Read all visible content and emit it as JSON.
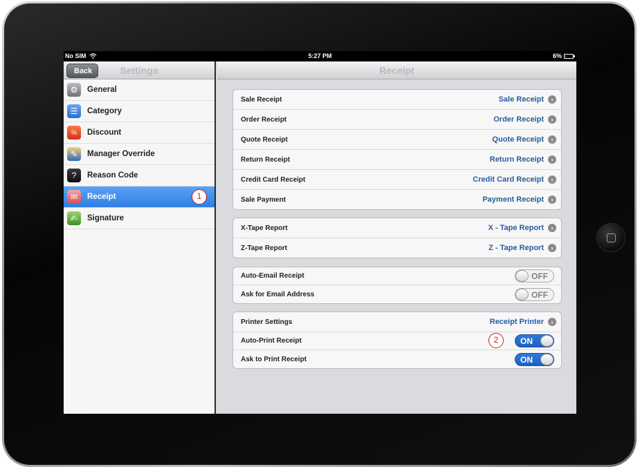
{
  "status_bar": {
    "carrier": "No SIM",
    "time": "5:27 PM",
    "battery": "6%"
  },
  "master": {
    "back_label": "Back",
    "title": "Settings",
    "items": [
      {
        "label": "General",
        "icon": "gear-icon",
        "active": false
      },
      {
        "label": "Category",
        "icon": "list-icon",
        "active": false
      },
      {
        "label": "Discount",
        "icon": "discount-tag-icon",
        "active": false
      },
      {
        "label": "Manager Override",
        "icon": "manager-icon",
        "active": false
      },
      {
        "label": "Reason Code",
        "icon": "reason-icon",
        "active": false
      },
      {
        "label": "Receipt",
        "icon": "receipt-icon",
        "active": true
      },
      {
        "label": "Signature",
        "icon": "signature-icon",
        "active": false
      }
    ]
  },
  "detail": {
    "title": "Receipt",
    "group1": [
      {
        "label": "Sale Receipt",
        "value": "Sale Receipt"
      },
      {
        "label": "Order Receipt",
        "value": "Order Receipt"
      },
      {
        "label": "Quote Receipt",
        "value": "Quote Receipt"
      },
      {
        "label": "Return Receipt",
        "value": "Return Receipt"
      },
      {
        "label": "Credit Card Receipt",
        "value": "Credit Card Receipt"
      },
      {
        "label": "Sale Payment",
        "value": "Payment Receipt"
      }
    ],
    "group2": [
      {
        "label": "X-Tape Report",
        "value": "X - Tape Report"
      },
      {
        "label": "Z-Tape Report",
        "value": "Z - Tape Report"
      }
    ],
    "group3": [
      {
        "label": "Auto-Email Receipt",
        "state": "OFF"
      },
      {
        "label": "Ask for Email Address",
        "state": "OFF"
      }
    ],
    "group4": {
      "printer": {
        "label": "Printer Settings",
        "value": "Receipt Printer"
      },
      "auto_print": {
        "label": "Auto-Print Receipt",
        "state": "ON"
      },
      "ask_print": {
        "label": "Ask to Print Receipt",
        "state": "ON"
      }
    }
  },
  "annotations": {
    "one": "1",
    "two": "2"
  },
  "colors": {
    "accent_blue": "#2f7ee3",
    "value_blue": "#2a5d9e",
    "annotation_red": "#c8211d"
  }
}
